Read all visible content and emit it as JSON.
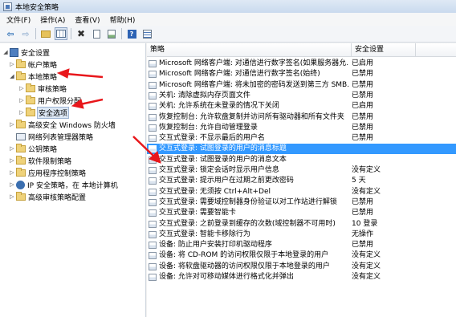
{
  "window": {
    "title": "本地安全策略"
  },
  "menu": [
    "文件(F)",
    "操作(A)",
    "查看(V)",
    "帮助(H)"
  ],
  "toolbar": [
    "back-icon",
    "forward-icon",
    "up-folder-icon",
    "show-tree-icon",
    "delete-icon",
    "properties-icon",
    "export-icon",
    "help-icon",
    "view-icon"
  ],
  "tree": [
    {
      "label": "安全设置",
      "icon": "shield-icon",
      "expanded": true
    },
    {
      "label": "帐户策略",
      "icon": "folder-icon"
    },
    {
      "label": "本地策略",
      "icon": "folder-icon",
      "expanded": true
    },
    {
      "label": "审核策略",
      "icon": "folder-icon"
    },
    {
      "label": "用户权限分配",
      "icon": "folder-icon"
    },
    {
      "label": "安全选项",
      "icon": "folder-icon",
      "selected": true
    },
    {
      "label": "高级安全 Windows 防火墙",
      "icon": "folder-icon"
    },
    {
      "label": "网络列表管理器策略",
      "icon": "network-icon"
    },
    {
      "label": "公钥策略",
      "icon": "folder-icon"
    },
    {
      "label": "软件限制策略",
      "icon": "folder-icon"
    },
    {
      "label": "应用程序控制策略",
      "icon": "folder-icon"
    },
    {
      "label": "IP 安全策略，在 本地计算机",
      "icon": "ip-security-icon"
    },
    {
      "label": "高级审核策略配置",
      "icon": "folder-icon"
    }
  ],
  "list": {
    "columns": [
      "策略",
      "安全设置"
    ],
    "rows": [
      {
        "policy": "Microsoft 网络客户端: 对通信进行数字签名(如果服务器允...",
        "setting": "已启用"
      },
      {
        "policy": "Microsoft 网络客户端: 对通信进行数字签名(始终)",
        "setting": "已禁用"
      },
      {
        "policy": "Microsoft 网络客户端: 将未加密的密码发送到第三方 SMB...",
        "setting": "已禁用"
      },
      {
        "policy": "关机: 清除虚拟内存页面文件",
        "setting": "已禁用"
      },
      {
        "policy": "关机: 允许系统在未登录的情况下关闭",
        "setting": "已启用"
      },
      {
        "policy": "恢复控制台: 允许软盘复制并访问所有驱动器和所有文件夹",
        "setting": "已禁用"
      },
      {
        "policy": "恢复控制台: 允许自动管理登录",
        "setting": "已禁用"
      },
      {
        "policy": "交互式登录: 不显示最后的用户名",
        "setting": "已禁用"
      },
      {
        "policy": "交互式登录: 试图登录的用户的消息标题",
        "setting": "",
        "selected": true
      },
      {
        "policy": "交互式登录: 试图登录的用户的消息文本",
        "setting": ""
      },
      {
        "policy": "交互式登录: 锁定会话时显示用户信息",
        "setting": "没有定义"
      },
      {
        "policy": "交互式登录: 提示用户在过期之前更改密码",
        "setting": "5 天"
      },
      {
        "policy": "交互式登录: 无须按 Ctrl+Alt+Del",
        "setting": "没有定义"
      },
      {
        "policy": "交互式登录: 需要域控制器身份验证以对工作站进行解锁",
        "setting": "已禁用"
      },
      {
        "policy": "交互式登录: 需要智能卡",
        "setting": "已禁用"
      },
      {
        "policy": "交互式登录: 之前登录到缓存的次数(域控制器不可用时)",
        "setting": "10 登录"
      },
      {
        "policy": "交互式登录: 智能卡移除行为",
        "setting": "无操作"
      },
      {
        "policy": "设备: 防止用户安装打印机驱动程序",
        "setting": "已禁用"
      },
      {
        "policy": "设备: 将 CD-ROM 的访问权限仅限于本地登录的用户",
        "setting": "没有定义"
      },
      {
        "policy": "设备: 将软盘驱动器的访问权限仅限于本地登录的用户",
        "setting": "没有定义"
      },
      {
        "policy": "设备: 允许对可移动媒体进行格式化并弹出",
        "setting": "没有定义"
      }
    ]
  }
}
